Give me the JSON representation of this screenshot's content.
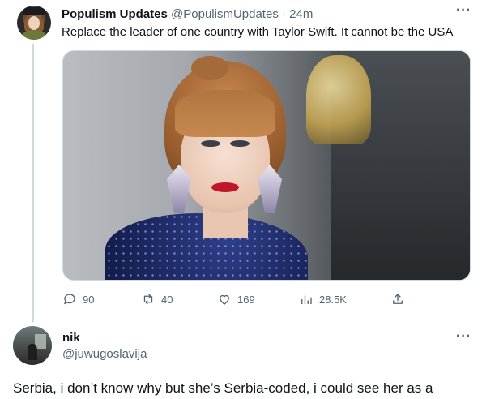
{
  "tweet": {
    "author_name": "Populism Updates",
    "handle": "@PopulismUpdates",
    "separator": "·",
    "time": "24m",
    "more": "···",
    "text": "Replace the leader of one country with Taylor Swift. It cannot be the USA",
    "media_alt": "Photo of a woman with red lips, bangs and sparkling earrings",
    "stats": {
      "replies": "90",
      "reposts": "40",
      "likes": "169",
      "views": "28.5K"
    },
    "icons": [
      "reply-icon",
      "repost-icon",
      "like-icon",
      "views-icon",
      "share-icon"
    ]
  },
  "reply": {
    "author_name": "nik",
    "handle": "@juwugoslavija",
    "more": "···",
    "text": "Serbia, i don’t know why but she’s Serbia-coded, i could see her as a"
  },
  "colors": {
    "text_primary": "#0f1419",
    "text_secondary": "#536471",
    "divider": "#cfd9de",
    "background": "#ffffff"
  }
}
